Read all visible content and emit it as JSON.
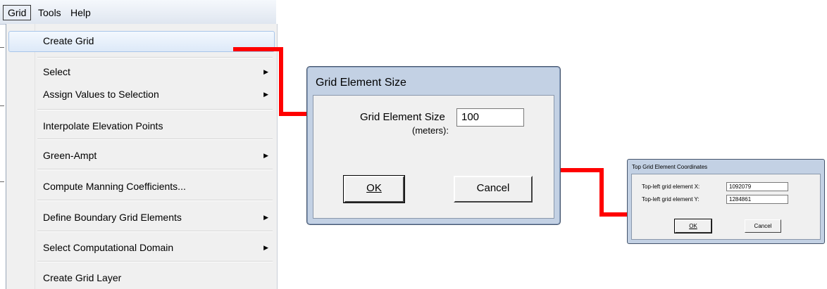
{
  "menubar": {
    "items": [
      {
        "label": "Grid"
      },
      {
        "label": "Tools"
      },
      {
        "label": "Help"
      }
    ]
  },
  "grid_menu": {
    "items": [
      {
        "label": "Create Grid",
        "submenu": false,
        "highlighted": true
      },
      {
        "label": "Select",
        "submenu": true
      },
      {
        "label": "Assign Values to Selection",
        "submenu": true
      },
      {
        "label": "Interpolate Elevation Points",
        "submenu": false
      },
      {
        "label": "Green-Ampt",
        "submenu": true
      },
      {
        "label": "Compute Manning Coefficients...",
        "submenu": false
      },
      {
        "label": "Define Boundary Grid Elements",
        "submenu": true
      },
      {
        "label": "Select Computational Domain",
        "submenu": true
      },
      {
        "label": "Create Grid Layer",
        "submenu": false
      }
    ],
    "submenu_glyph": "▶"
  },
  "grid_size_dialog": {
    "title": "Grid Element Size",
    "label_line1": "Grid Element Size",
    "label_line2": "(meters):",
    "value": "100",
    "ok_label": "OK",
    "cancel_label": "Cancel"
  },
  "coords_dialog": {
    "title": "Top Grid Element Coordinates",
    "x_label": "Top-left grid element X:",
    "x_value": "1092079",
    "y_label": "Top-left grid element Y:",
    "y_value": "1284861",
    "ok_label": "OK",
    "cancel_label": "Cancel"
  },
  "colors": {
    "arrow": "#ff0000",
    "dialog_frame": "#c3d1e4"
  }
}
